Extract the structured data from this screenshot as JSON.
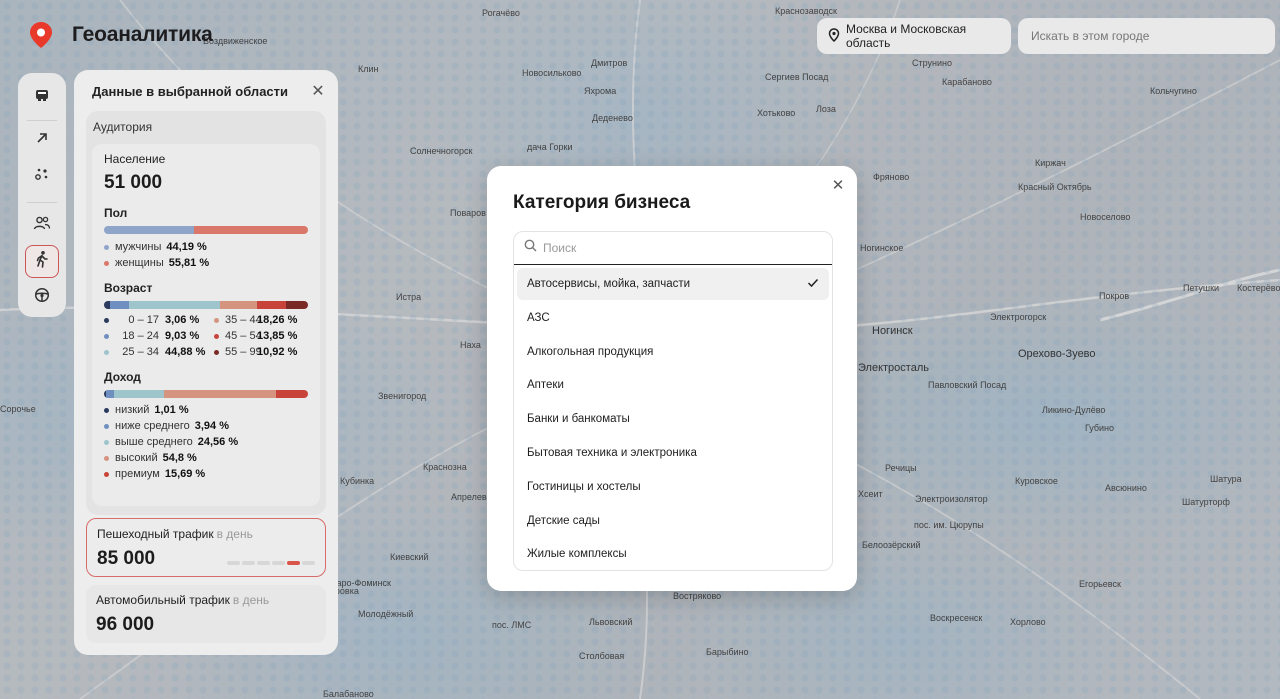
{
  "app": {
    "title": "Геоаналитика"
  },
  "header": {
    "region": "Москва и Московская область",
    "search_placeholder": "Искать в этом городе"
  },
  "toolbar": {
    "items": [
      {
        "icon": "layers-icon",
        "active": false
      },
      {
        "icon": "arrow-up-right-icon",
        "active": false
      },
      {
        "icon": "points-icon",
        "active": false
      },
      {
        "icon": "people-icon",
        "active": false
      },
      {
        "icon": "pedestrian-icon",
        "active": true
      },
      {
        "icon": "steering-wheel-icon",
        "active": false
      }
    ]
  },
  "panel": {
    "title": "Данные в выбранной области",
    "audience_label": "Аудитория",
    "population_label": "Население",
    "population_value": "51 000",
    "gender": {
      "label": "Пол",
      "items": [
        {
          "name": "мужчины",
          "value": "44,19 %",
          "share": 44.19,
          "color": "#8fa4c9"
        },
        {
          "name": "женщины",
          "value": "55,81 %",
          "share": 55.81,
          "color": "#d9786a"
        }
      ]
    },
    "age": {
      "label": "Возраст",
      "items": [
        {
          "range": "0 – 17",
          "value": "3,06 %",
          "share": 3.06,
          "color": "#2b3a5c"
        },
        {
          "range": "18 – 24",
          "value": "9,03 %",
          "share": 9.03,
          "color": "#6f8fc0"
        },
        {
          "range": "25 – 34",
          "value": "44,88 %",
          "share": 44.88,
          "color": "#9ec4cc"
        },
        {
          "range": "35 – 44",
          "value": "18,26 %",
          "share": 18.26,
          "color": "#d49480"
        },
        {
          "range": "45 – 54",
          "value": "13,85 %",
          "share": 13.85,
          "color": "#c8443a"
        },
        {
          "range": "55 – 99",
          "value": "10,92 %",
          "share": 10.92,
          "color": "#7a2a25"
        }
      ]
    },
    "income": {
      "label": "Доход",
      "items": [
        {
          "name": "низкий",
          "value": "1,01 %",
          "share": 1.01,
          "color": "#2b3a5c"
        },
        {
          "name": "ниже среднего",
          "value": "3,94 %",
          "share": 3.94,
          "color": "#6f8fc0"
        },
        {
          "name": "выше среднего",
          "value": "24,56 %",
          "share": 24.56,
          "color": "#9ec4cc"
        },
        {
          "name": "высокий",
          "value": "54,8 %",
          "share": 54.8,
          "color": "#d49480"
        },
        {
          "name": "премиум",
          "value": "15,69 %",
          "share": 15.69,
          "color": "#c8443a"
        }
      ]
    },
    "pedestrian": {
      "label": "Пешеходный трафик",
      "unit": "в день",
      "value": "85 000",
      "level": 5,
      "levels": 6
    },
    "auto": {
      "label": "Автомобильный трафик",
      "unit": "в день",
      "value": "96 000"
    }
  },
  "modal": {
    "title": "Категория бизнеса",
    "search_placeholder": "Поиск",
    "options": [
      {
        "label": "Автосервисы, мойка, запчасти",
        "selected": true
      },
      {
        "label": "АЗС",
        "selected": false
      },
      {
        "label": "Алкогольная продукция",
        "selected": false
      },
      {
        "label": "Аптеки",
        "selected": false
      },
      {
        "label": "Банки и банкоматы",
        "selected": false
      },
      {
        "label": "Бытовая техника и электроника",
        "selected": false
      },
      {
        "label": "Гостиницы и хостелы",
        "selected": false
      },
      {
        "label": "Детские сады",
        "selected": false
      },
      {
        "label": "Жилые комплексы",
        "selected": false
      }
    ]
  },
  "map_labels": [
    {
      "text": "Рогачёво"
    },
    {
      "text": "Краснозаводск"
    },
    {
      "text": "Воздвиженское"
    },
    {
      "text": "Новосильково"
    },
    {
      "text": "Клин"
    },
    {
      "text": "Дмитров"
    },
    {
      "text": "Сергиев Посад"
    },
    {
      "text": "Струнино"
    },
    {
      "text": "Карабаново"
    },
    {
      "text": "Кольчугино"
    },
    {
      "text": "Яхрома"
    },
    {
      "text": "Хотьково"
    },
    {
      "text": "Лоза"
    },
    {
      "text": "Деденево"
    },
    {
      "text": "Солнечногорск"
    },
    {
      "text": "дача Горки"
    },
    {
      "text": "Фряново"
    },
    {
      "text": "Киржач"
    },
    {
      "text": "Красный Октябрь"
    },
    {
      "text": "Новоселово"
    },
    {
      "text": "Поваров"
    },
    {
      "text": "Ногинское"
    },
    {
      "text": "Истра"
    },
    {
      "text": "Наха"
    },
    {
      "text": "Ногинск"
    },
    {
      "text": "Электрогорск"
    },
    {
      "text": "Покров"
    },
    {
      "text": "Петушки"
    },
    {
      "text": "Костерёво"
    },
    {
      "text": "Орехово-Зуево"
    },
    {
      "text": "Электросталь"
    },
    {
      "text": "Павловский Посад"
    },
    {
      "text": "Звенигород"
    },
    {
      "text": "Ликино-Дулёво"
    },
    {
      "text": "Губино"
    },
    {
      "text": "Речицы"
    },
    {
      "text": "Куровское"
    },
    {
      "text": "Шатура"
    },
    {
      "text": "Авсюнино"
    },
    {
      "text": "Шатурторф"
    },
    {
      "text": "Кубинка"
    },
    {
      "text": "Краснозна"
    },
    {
      "text": "Апрелев"
    },
    {
      "text": "Хсеит"
    },
    {
      "text": "Электроизолятор"
    },
    {
      "text": "пос. им. Цюрупы"
    },
    {
      "text": "Белоозёрский"
    },
    {
      "text": "Уваровка"
    },
    {
      "text": "Киевский"
    },
    {
      "text": "Наро-Фоминск"
    },
    {
      "text": "Егорьевск"
    },
    {
      "text": "Заворово"
    },
    {
      "text": "Молодёжный"
    },
    {
      "text": "пос. ЛМС"
    },
    {
      "text": "Львовский"
    },
    {
      "text": "Воскресенск"
    },
    {
      "text": "Хорлово"
    },
    {
      "text": "Столбовая"
    },
    {
      "text": "Барыбино"
    },
    {
      "text": "Балабаново"
    },
    {
      "text": "Сорочье"
    },
    {
      "text": "Востряково"
    }
  ]
}
